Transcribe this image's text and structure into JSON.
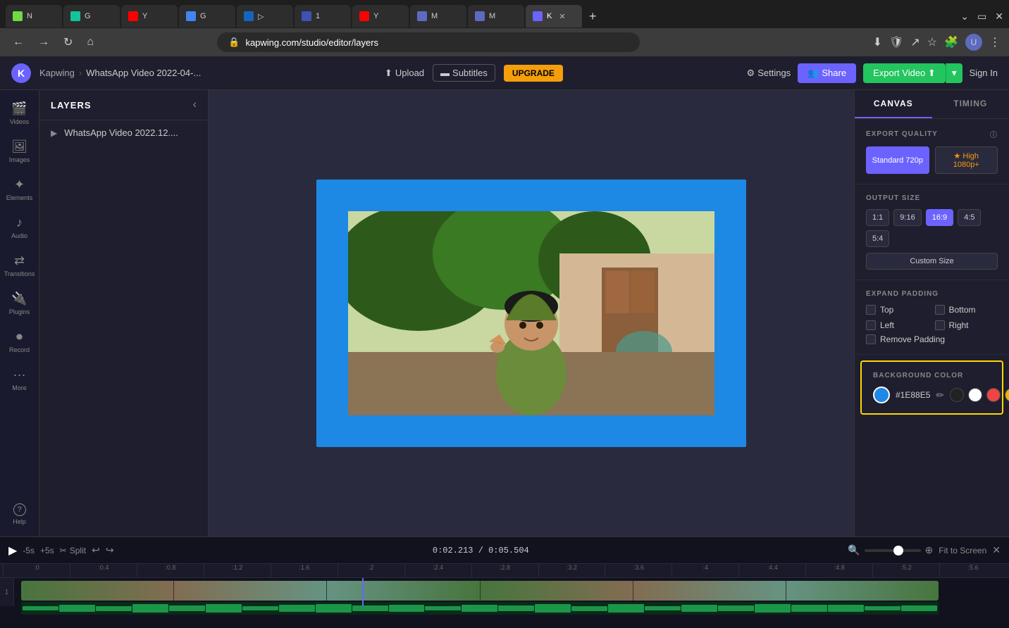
{
  "browser": {
    "tabs": [
      {
        "label": "N",
        "color": "#6fda44",
        "active": false
      },
      {
        "label": "G",
        "color": "#15c39a",
        "active": false
      },
      {
        "label": "Y",
        "color": "#ff0000",
        "active": false
      },
      {
        "label": "G",
        "color": "#4285f4",
        "active": false
      },
      {
        "label": ">",
        "color": "#1565c0",
        "active": false
      },
      {
        "label": "1",
        "color": "#e53935",
        "active": false
      },
      {
        "label": "Y",
        "color": "#ff0000",
        "active": false
      },
      {
        "label": "K",
        "color": "#6c63ff",
        "active": true
      }
    ],
    "url": "kapwing.com/studio/editor/layers",
    "active_tab_title": "K",
    "new_tab_label": "+"
  },
  "app_header": {
    "logo": "K",
    "brand": "Kapwing",
    "separator": ">",
    "project": "WhatsApp Video 2022-04-...",
    "upload_label": "Upload",
    "subtitles_label": "Subtitles",
    "upgrade_label": "UPGRADE",
    "settings_label": "Settings",
    "share_label": "Share",
    "export_label": "Export Video",
    "signin_label": "Sign In"
  },
  "left_sidebar": {
    "items": [
      {
        "icon": "🎬",
        "label": "Videos"
      },
      {
        "icon": "🖼",
        "label": "Images"
      },
      {
        "icon": "✦",
        "label": "Elements"
      },
      {
        "icon": "♪",
        "label": "Audio"
      },
      {
        "icon": "↔",
        "label": "Transitions"
      },
      {
        "icon": "🔌",
        "label": "Plugins"
      },
      {
        "icon": "⏺",
        "label": "Record"
      },
      {
        "icon": "•••",
        "label": "More"
      },
      {
        "icon": "?",
        "label": "Help"
      }
    ]
  },
  "layers_panel": {
    "title": "LAYERS",
    "items": [
      {
        "label": "WhatsApp Video 2022.12...."
      }
    ]
  },
  "right_panel": {
    "tabs": [
      {
        "label": "CANVAS",
        "active": true
      },
      {
        "label": "TIMING",
        "active": false
      }
    ],
    "export_quality": {
      "label": "EXPORT QUALITY",
      "options": [
        {
          "label": "Standard 720p",
          "active": true
        },
        {
          "label": "★ High 1080p+",
          "premium": true
        }
      ]
    },
    "output_size": {
      "label": "OUTPUT SIZE",
      "options": [
        {
          "label": "1:1"
        },
        {
          "label": "9:16"
        },
        {
          "label": "16:9",
          "active": true
        },
        {
          "label": "4:5"
        },
        {
          "label": "5:4"
        }
      ],
      "custom_label": "Custom Size"
    },
    "expand_padding": {
      "label": "EXPAND PADDING",
      "options": [
        {
          "label": "Top"
        },
        {
          "label": "Bottom"
        },
        {
          "label": "Left"
        },
        {
          "label": "Right"
        },
        {
          "label": "Remove Padding",
          "full_width": true
        }
      ]
    },
    "background_color": {
      "label": "BACKGROUND COLOR",
      "current_color": "#1E88E5",
      "hex_label": "#1E88E5",
      "swatches": [
        {
          "color": "#222",
          "name": "black"
        },
        {
          "color": "#fff",
          "name": "white"
        },
        {
          "color": "#ef4444",
          "name": "red"
        },
        {
          "color": "#eab308",
          "name": "yellow"
        },
        {
          "color": "#3b82f6",
          "name": "blue"
        }
      ]
    }
  },
  "timeline": {
    "time_current": "0:02.213",
    "time_total": "0:05.504",
    "skip_back": "-5s",
    "skip_forward": "+5s",
    "split_label": "Split",
    "fit_screen_label": "Fit to Screen",
    "ruler_marks": [
      ":0",
      ":0.4",
      ":0.8",
      ":1.2",
      ":1.6",
      ":2",
      ":2.4",
      ":2.8",
      ":3.2",
      ":3.6",
      ":4",
      ":4.4",
      ":4.8",
      ":5.2",
      ":5.6"
    ]
  }
}
